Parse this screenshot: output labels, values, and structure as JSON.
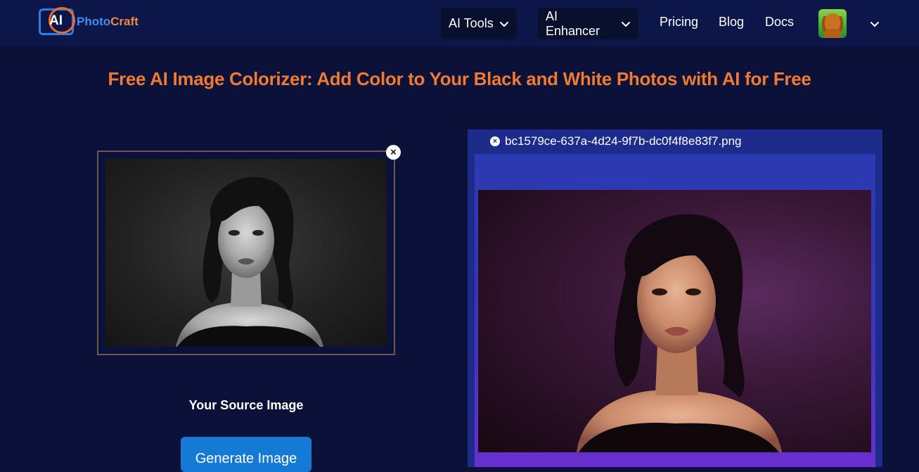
{
  "header": {
    "logo": {
      "ai": "AI",
      "photo": "Photo",
      "craft": "Craft"
    },
    "nav": {
      "ai_tools": "AI Tools",
      "ai_enhancer": "AI Enhancer",
      "pricing": "Pricing",
      "blog": "Blog",
      "docs": "Docs"
    },
    "icons": {
      "dropdown": "chevron-down-icon",
      "avatar": "dog-avatar"
    }
  },
  "main": {
    "headline": "Free AI Image Colorizer: Add Color to Your Black and White Photos with AI for Free",
    "source": {
      "label": "Your Source Image",
      "remove_symbol": "×"
    },
    "generate_button": "Generate Image",
    "result": {
      "file_name": "bc1579ce-637a-4d24-9f7b-dc0f4f8e83f7.png",
      "remove_symbol": "×"
    }
  },
  "colors": {
    "background": "#0b1138",
    "navbar": "#0d1648",
    "accent_orange": "#ef7b32",
    "button_blue": "#1579d6",
    "result_panel": "#1d2b8a"
  }
}
